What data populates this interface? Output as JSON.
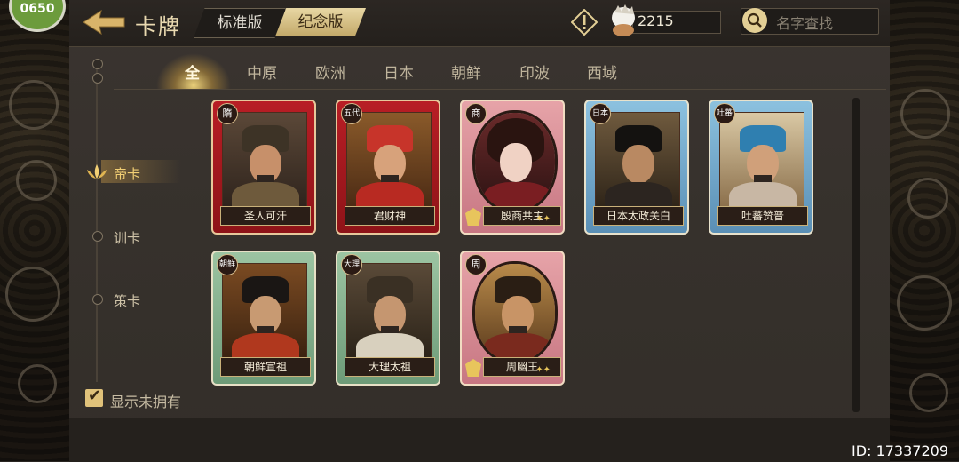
{
  "app": {
    "title": "卡牌"
  },
  "versions": {
    "standard": "标准版",
    "commemorative": "纪念版"
  },
  "currency": {
    "value": "2215"
  },
  "search": {
    "placeholder": "名字查找"
  },
  "badge_corner": "0650",
  "tabs": [
    "全",
    "中原",
    "欧洲",
    "日本",
    "朝鲜",
    "印波",
    "西域"
  ],
  "categories": [
    "帝卡",
    "训卡",
    "策卡"
  ],
  "show_unowned": "显示未拥有",
  "user_id": "ID: 17337209",
  "cards": [
    {
      "name": "圣人可汗",
      "badge": "隋"
    },
    {
      "name": "君财神",
      "badge": "五代"
    },
    {
      "name": "殷商共主",
      "badge": "商"
    },
    {
      "name": "日本太政关白",
      "badge": "日本"
    },
    {
      "name": "吐蕃赞普",
      "badge": "吐蕃"
    },
    {
      "name": "朝鲜宣祖",
      "badge": "朝鲜"
    },
    {
      "name": "大理太祖",
      "badge": "大理"
    },
    {
      "name": "周幽王",
      "badge": "周"
    }
  ],
  "colors": {
    "gold": "#e3cf95",
    "red_card": "#b81e25",
    "pink_card": "#e6a3a8",
    "blue_card": "#8cc1df",
    "green_card": "#9cc4a2"
  }
}
